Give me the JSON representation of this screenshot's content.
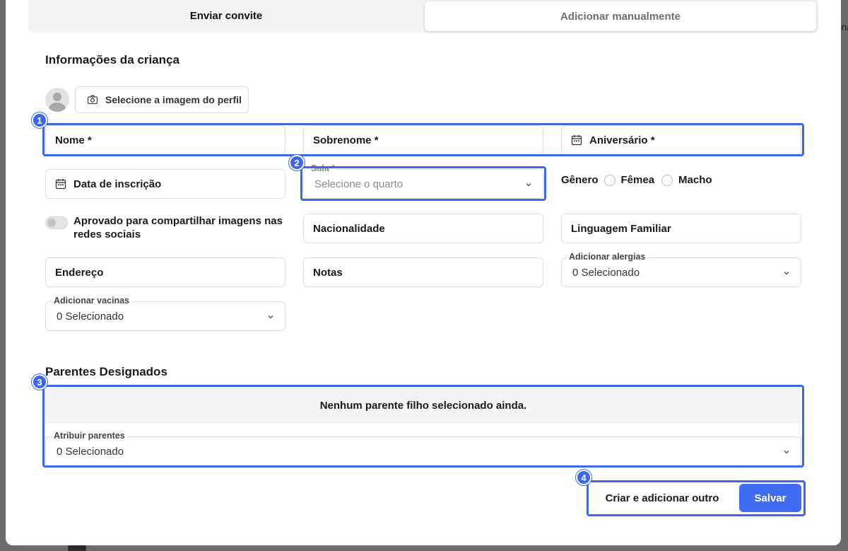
{
  "tabs": [
    {
      "label": "Enviar convite"
    },
    {
      "label": "Adicionar manualmente"
    }
  ],
  "edge_text": "na",
  "child_section": {
    "title": "Informações da criança",
    "select_image_label": "Selecione a imagem do perfil"
  },
  "fields": {
    "first_name": "Nome *",
    "last_name": "Sobrenome *",
    "birthday": "Aniversário *",
    "enrollment_date": "Data de inscrição",
    "room_label": "Sala *",
    "room_placeholder": "Selecione o quarto",
    "nationality": "Nacionalidade",
    "family_language": "Linguagem Familiar",
    "address": "Endereço",
    "notes": "Notas",
    "allergies_label": "Adicionar alergias",
    "allergies_value": "0 Selecionado",
    "vaccines_label": "Adicionar vacinas",
    "vaccines_value": "0 Selecionado"
  },
  "gender": {
    "label": "Gênero",
    "options": [
      "Fêmea",
      "Macho"
    ]
  },
  "social_toggle": {
    "label": "Aprovado para compartilhar imagens nas redes sociais",
    "enabled": false
  },
  "parents_section": {
    "title": "Parentes Designados",
    "empty_message": "Nenhum parente filho selecionado ainda.",
    "assign_label": "Atribuir parentes",
    "assign_value": "0 Selecionado"
  },
  "actions": {
    "create_another": "Criar e adicionar outro",
    "save": "Salvar"
  },
  "markers": [
    "1",
    "2",
    "3",
    "4"
  ],
  "colors": {
    "accent": "#3d67e6",
    "primary_button": "#3f6cf0"
  }
}
